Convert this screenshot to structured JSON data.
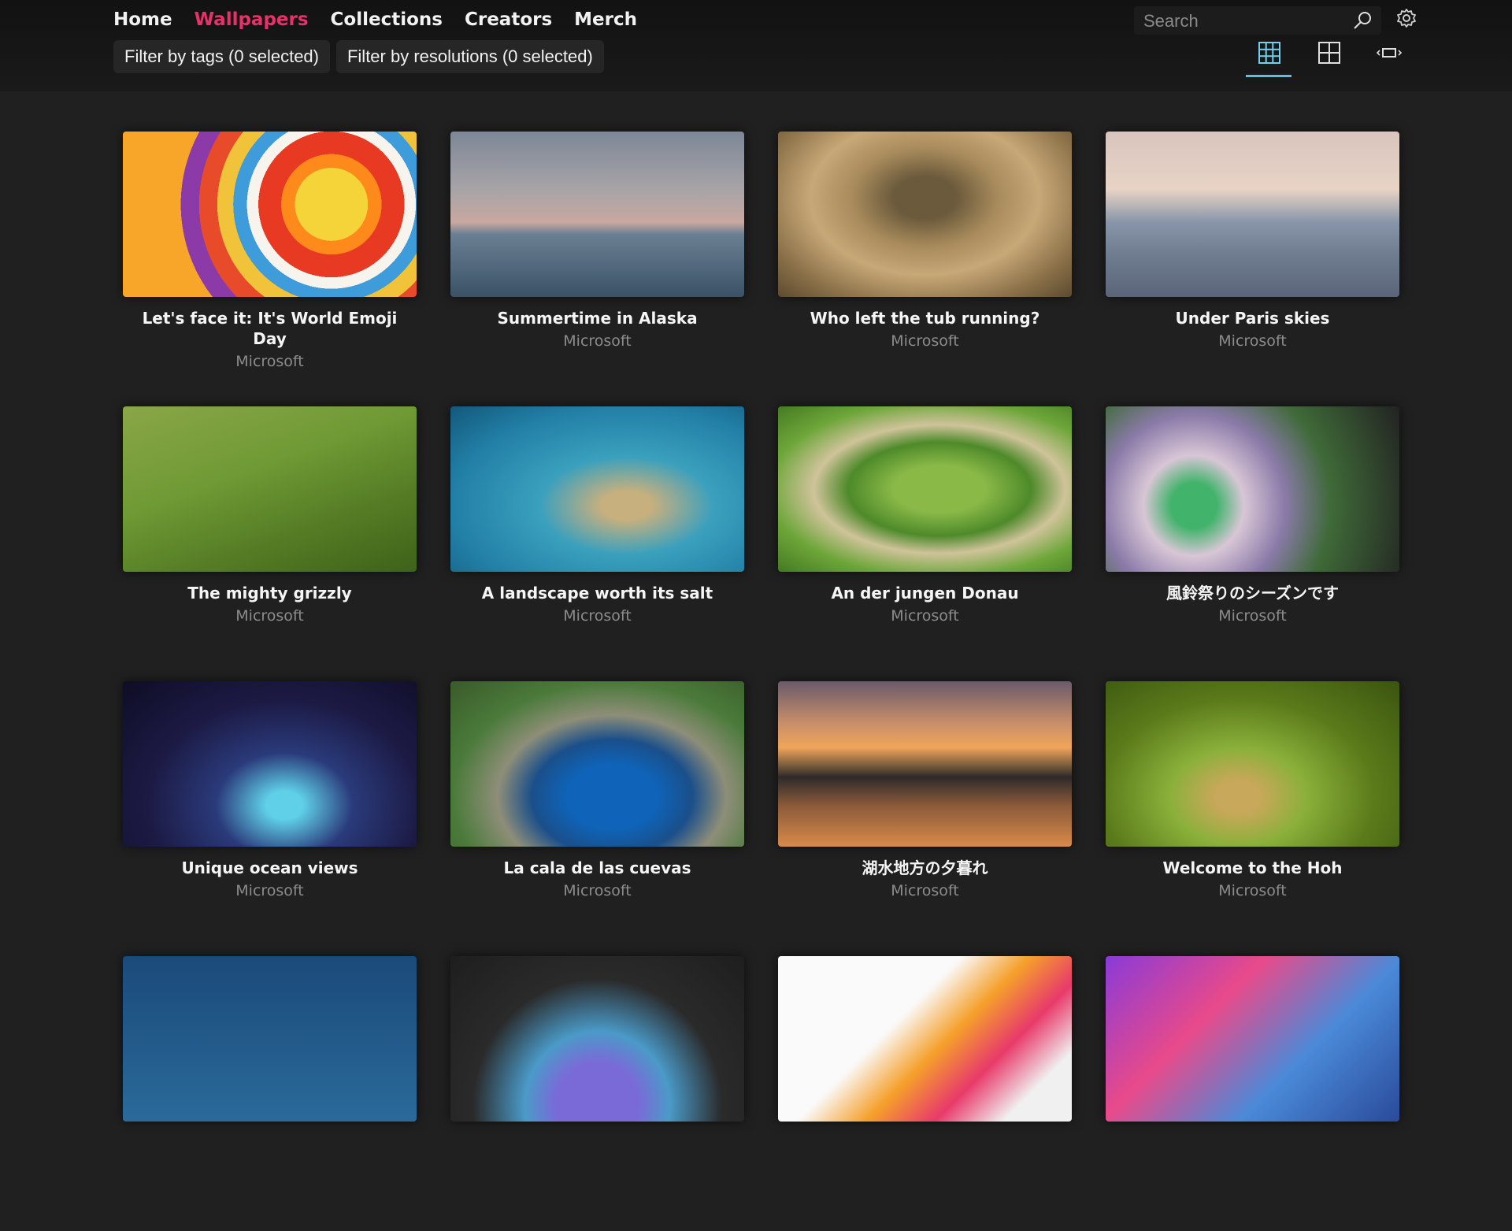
{
  "nav": {
    "items": [
      {
        "label": "Home",
        "active": false
      },
      {
        "label": "Wallpapers",
        "active": true
      },
      {
        "label": "Collections",
        "active": false
      },
      {
        "label": "Creators",
        "active": false
      },
      {
        "label": "Merch",
        "active": false
      }
    ]
  },
  "filters": {
    "tags_label": "Filter by tags (0 selected)",
    "resolutions_label": "Filter by resolutions (0 selected)"
  },
  "search": {
    "placeholder": "Search"
  },
  "view_modes": {
    "selected": "grid-small",
    "options": [
      "grid-small",
      "grid-large",
      "single"
    ]
  },
  "colors": {
    "accent": "#e8316b",
    "selected_indicator": "#5bc0e8",
    "background": "#202020"
  },
  "wallpapers": [
    {
      "title": "Let's face it: It's World Emoji Day",
      "author": "Microsoft"
    },
    {
      "title": "Summertime in Alaska",
      "author": "Microsoft"
    },
    {
      "title": "Who left the tub running?",
      "author": "Microsoft"
    },
    {
      "title": "Under Paris skies",
      "author": "Microsoft"
    },
    {
      "title": "The mighty grizzly",
      "author": "Microsoft"
    },
    {
      "title": "A landscape worth its salt",
      "author": "Microsoft"
    },
    {
      "title": "An der jungen Donau",
      "author": "Microsoft"
    },
    {
      "title": "風鈴祭りのシーズンです",
      "author": "Microsoft"
    },
    {
      "title": "Unique ocean views",
      "author": "Microsoft"
    },
    {
      "title": "La cala de las cuevas",
      "author": "Microsoft"
    },
    {
      "title": "湖水地方の夕暮れ",
      "author": "Microsoft"
    },
    {
      "title": "Welcome to the Hoh",
      "author": "Microsoft"
    },
    {
      "title": "",
      "author": ""
    },
    {
      "title": "",
      "author": ""
    },
    {
      "title": "",
      "author": ""
    },
    {
      "title": "",
      "author": ""
    }
  ]
}
